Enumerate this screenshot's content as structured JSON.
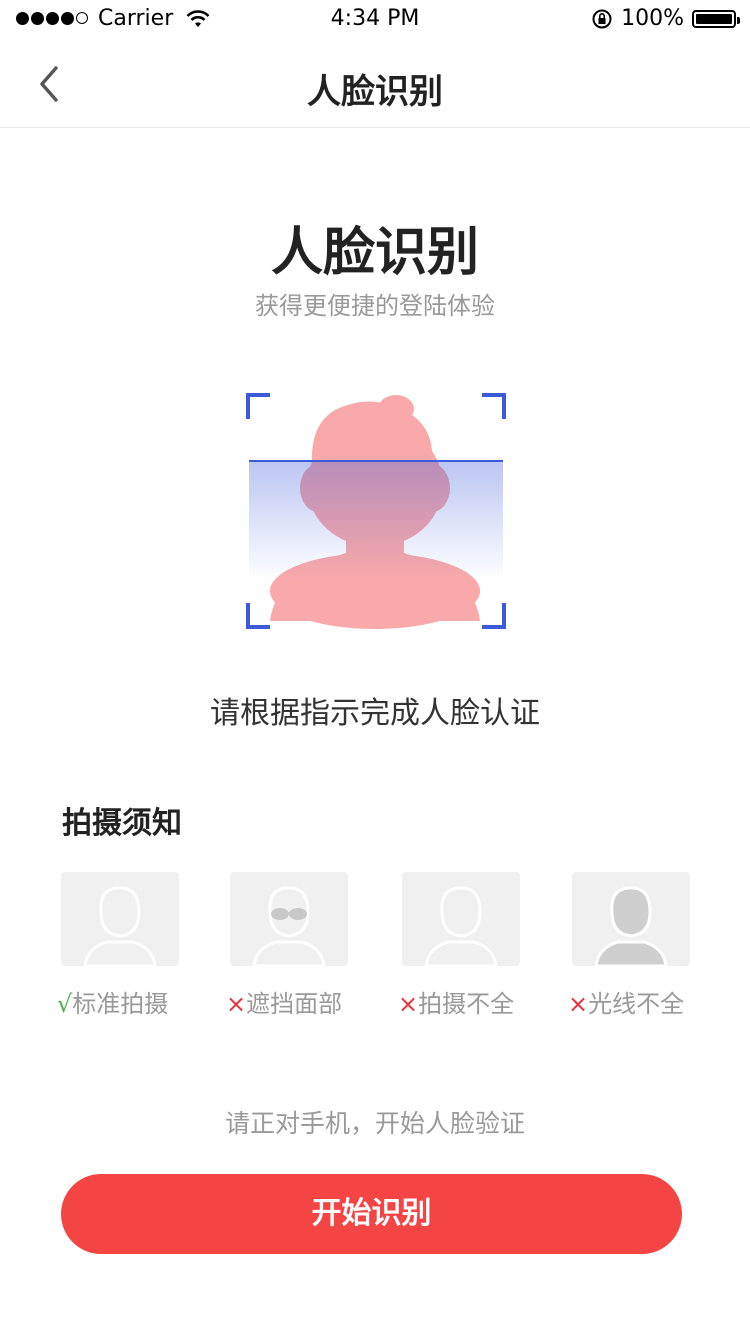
{
  "status_bar": {
    "carrier": "Carrier",
    "time": "4:34 PM",
    "battery": "100%",
    "signal_bars": 4
  },
  "nav": {
    "title": "人脸识别"
  },
  "hero": {
    "title": "人脸识别",
    "subtitle": "获得更便捷的登陆体验"
  },
  "instruction": "请根据指示完成人脸认证",
  "tips": {
    "title": "拍摄须知",
    "items": [
      {
        "mark": "√",
        "label": "标准拍摄"
      },
      {
        "mark": "×",
        "label": "遮挡面部"
      },
      {
        "mark": "×",
        "label": "拍摄不全"
      },
      {
        "mark": "×",
        "label": "光线不全"
      }
    ]
  },
  "hint": "请正对手机，开始人脸验证",
  "button": {
    "label": "开始识别"
  },
  "colors": {
    "accent": "#f44444",
    "scan_frame": "#3b5bdb",
    "avatar": "#f9a9a9"
  }
}
